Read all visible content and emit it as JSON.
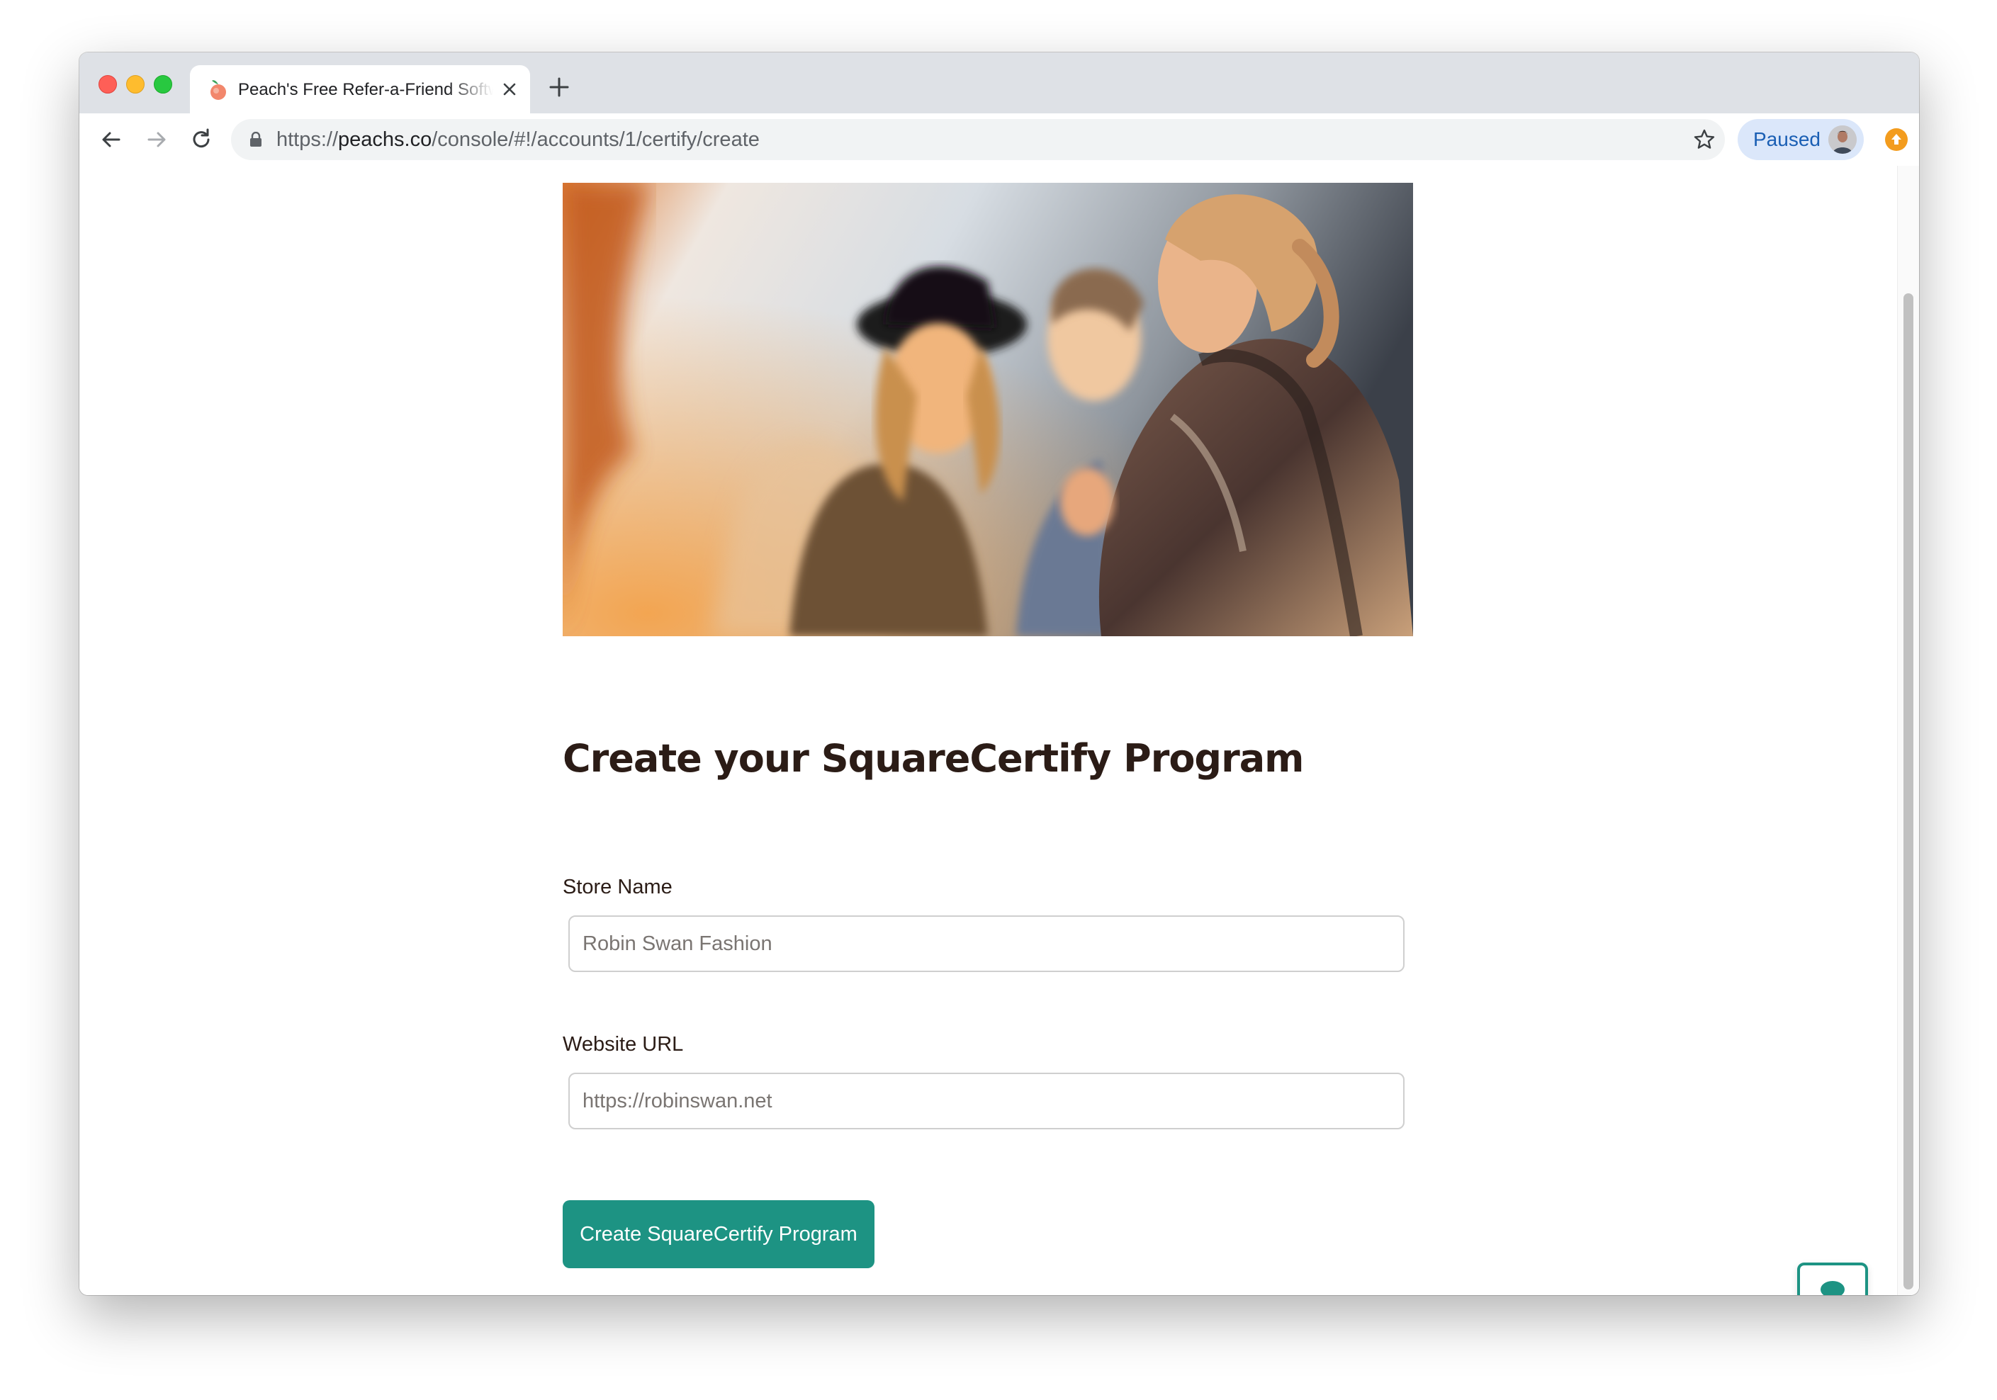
{
  "browser": {
    "tab_title": "Peach's Free Refer-a-Friend Software",
    "url_scheme": "https://",
    "url_host": "peachs.co",
    "url_path": "/console/#!/accounts/1/certify/create",
    "profile_status": "Paused"
  },
  "page": {
    "title": "Create your SquareCertify Program",
    "store_name": {
      "label": "Store Name",
      "placeholder": "Robin Swan Fashion",
      "value": ""
    },
    "website_url": {
      "label": "Website URL",
      "placeholder": "https://robinswan.net",
      "value": ""
    },
    "submit_label": "Create SquareCertify Program"
  },
  "colors": {
    "accent": "#1d9383",
    "heading_text": "#2b1c16",
    "profile_chip": "#dbe7fa"
  },
  "icons": {
    "favicon": "peach-icon",
    "tab_close": "close-icon",
    "new_tab": "plus-icon",
    "back": "arrow-left-icon",
    "forward": "arrow-right-icon",
    "reload": "reload-icon",
    "lock": "lock-icon",
    "bookmark": "star-icon",
    "extension": "extension-icon",
    "chat": "chat-bubble-icon"
  }
}
